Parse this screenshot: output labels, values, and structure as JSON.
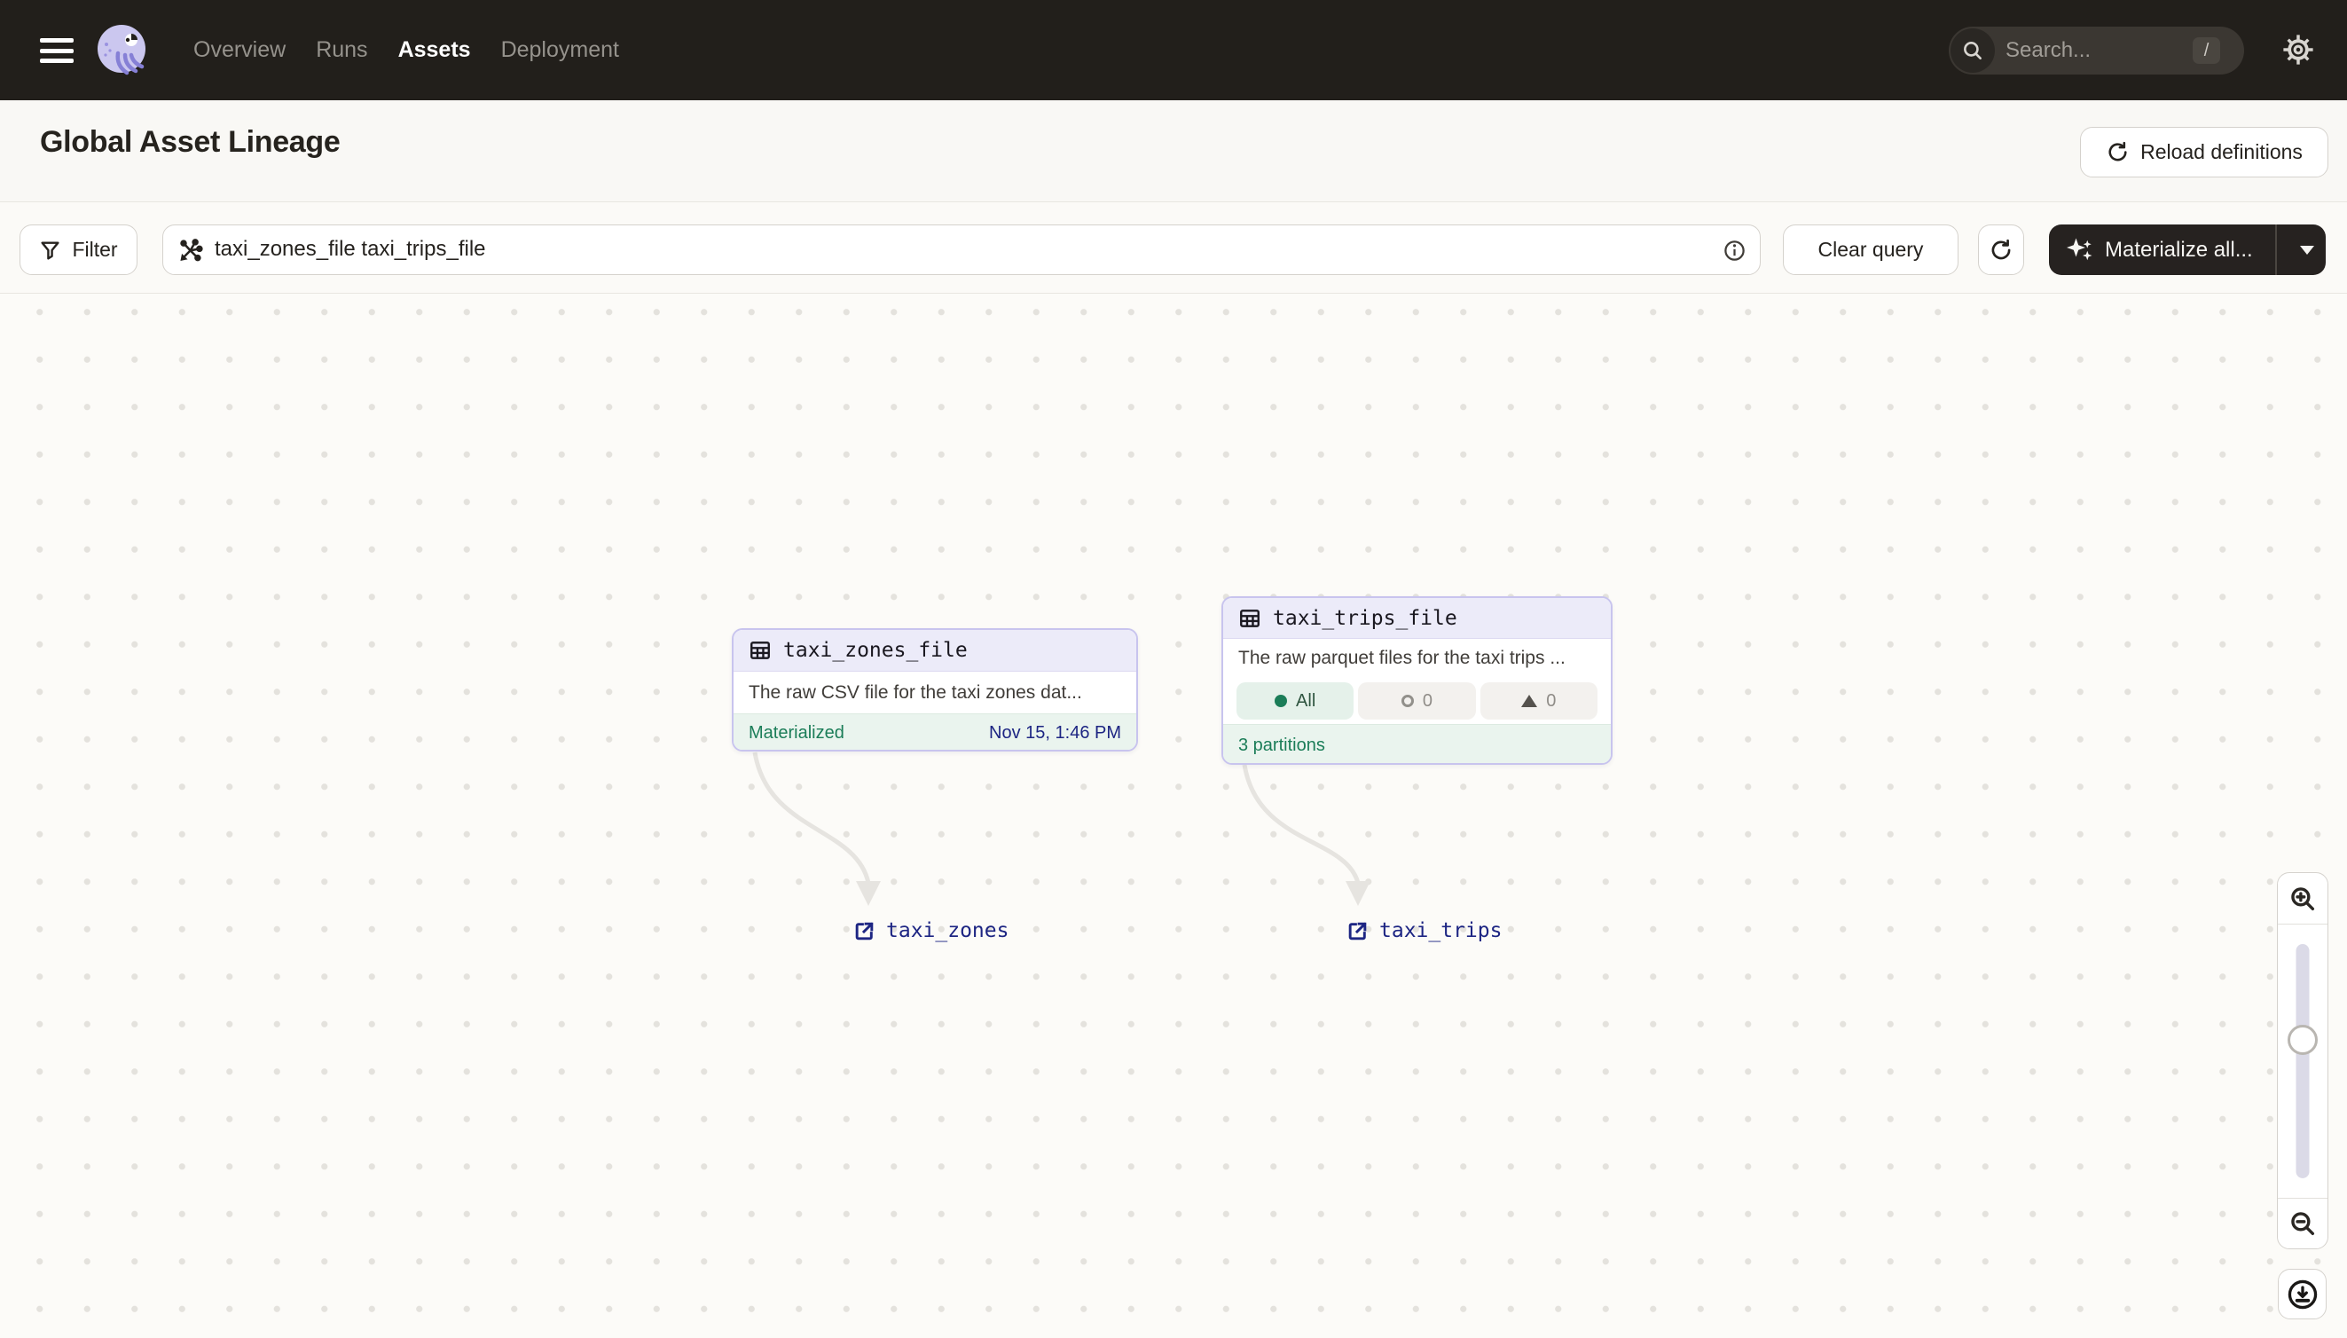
{
  "topbar": {
    "nav_items": [
      {
        "label": "Overview",
        "active": false
      },
      {
        "label": "Runs",
        "active": false
      },
      {
        "label": "Assets",
        "active": true
      },
      {
        "label": "Deployment",
        "active": false
      }
    ],
    "search": {
      "placeholder": "Search...",
      "shortcut": "/"
    }
  },
  "header": {
    "title": "Global Asset Lineage",
    "reload_label": "Reload definitions"
  },
  "toolbar": {
    "filter_label": "Filter",
    "query_value": "taxi_zones_file taxi_trips_file",
    "clear_label": "Clear query",
    "materialize_label": "Materialize all..."
  },
  "graph": {
    "nodes": {
      "zones": {
        "title": "taxi_zones_file",
        "description": "The raw CSV file for the taxi zones dat...",
        "status": "Materialized",
        "timestamp": "Nov 15, 1:46 PM"
      },
      "trips": {
        "title": "taxi_trips_file",
        "description": "The raw parquet files for the taxi trips ...",
        "partition_all_label": "All",
        "partition_failed_count": "0",
        "partition_missing_count": "0",
        "footer": "3 partitions"
      }
    },
    "links": {
      "zones": "taxi_zones",
      "trips": "taxi_trips"
    }
  },
  "colors": {
    "topbar_bg": "#221F1B",
    "accent_green": "#1B7D58",
    "link_navy": "#1D2583",
    "node_border": "#C8C4EE",
    "node_header_bg": "#ECEBF9",
    "node_footer_bg": "#EAF4EE"
  }
}
